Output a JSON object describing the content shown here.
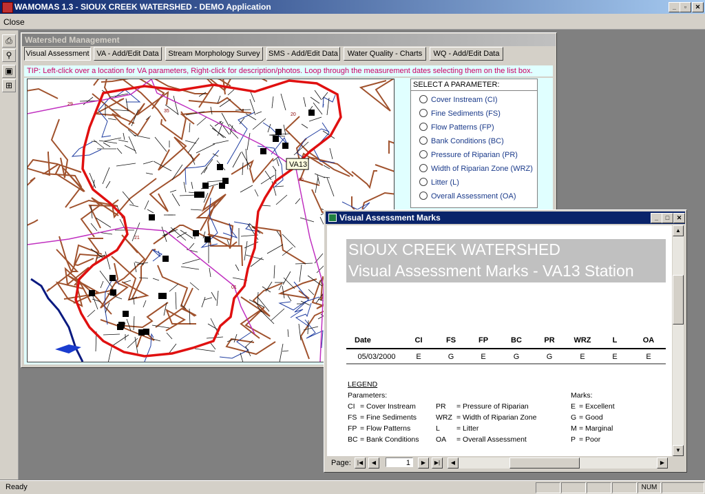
{
  "app": {
    "title": "WAMOMAS 1.3 - SIOUX CREEK WATERSHED - DEMO Application"
  },
  "menu": {
    "close": "Close"
  },
  "mdi": {
    "title": "Watershed Management",
    "tabs": [
      "Visual Assessment",
      "VA - Add/Edit Data",
      "Stream Morphology Survey",
      "SMS - Add/Edit Data",
      "Water Quality - Charts",
      "WQ - Add/Edit Data"
    ],
    "tip": "TIP: Left-click over a location for VA parameters,  Right-click for description/photos. Loop through the measurement dates selecting them on the list box."
  },
  "map": {
    "station_label": "VA13",
    "labels": [
      "29",
      "35",
      "20",
      "21",
      "40",
      "01"
    ]
  },
  "params": {
    "header": "SELECT A PARAMETER:",
    "options": [
      "Cover Instream (CI)",
      "Fine Sediments (FS)",
      "Flow Patterns (FP)",
      "Bank Conditions (BC)",
      "Pressure of Riparian (PR)",
      "Width of Riparian Zone (WRZ)",
      "Litter (L)",
      "Overall Assessment (OA)"
    ]
  },
  "report": {
    "window_title": "Visual Assessment Marks",
    "heading1": "SIOUX CREEK WATERSHED",
    "heading2": "Visual Assessment Marks - VA13 Station",
    "columns": [
      "Date",
      "CI",
      "FS",
      "FP",
      "BC",
      "PR",
      "WRZ",
      "L",
      "OA"
    ],
    "rows": [
      [
        "05/03/2000",
        "E",
        "G",
        "E",
        "G",
        "G",
        "E",
        "E",
        "E"
      ]
    ],
    "legend_title": "LEGEND",
    "parameters_label": "Parameters:",
    "marks_label": "Marks:",
    "legend_params": [
      [
        "CI",
        "= Cover Instream",
        "PR",
        "= Pressure of Riparian"
      ],
      [
        "FS",
        "= Fine Sediments",
        "WRZ",
        "= Width of Riparian Zone"
      ],
      [
        "FP",
        "= Flow Patterns",
        "L",
        "= Litter"
      ],
      [
        "BC",
        "= Bank Conditions",
        "OA",
        "= Overall Assessment"
      ]
    ],
    "legend_marks": [
      [
        "E",
        "= Excellent"
      ],
      [
        "G",
        "= Good"
      ],
      [
        "M",
        "= Marginal"
      ],
      [
        "P",
        "= Poor"
      ]
    ],
    "page_label": "Page:",
    "page_value": "1"
  },
  "status": {
    "ready": "Ready",
    "num": "NUM"
  }
}
